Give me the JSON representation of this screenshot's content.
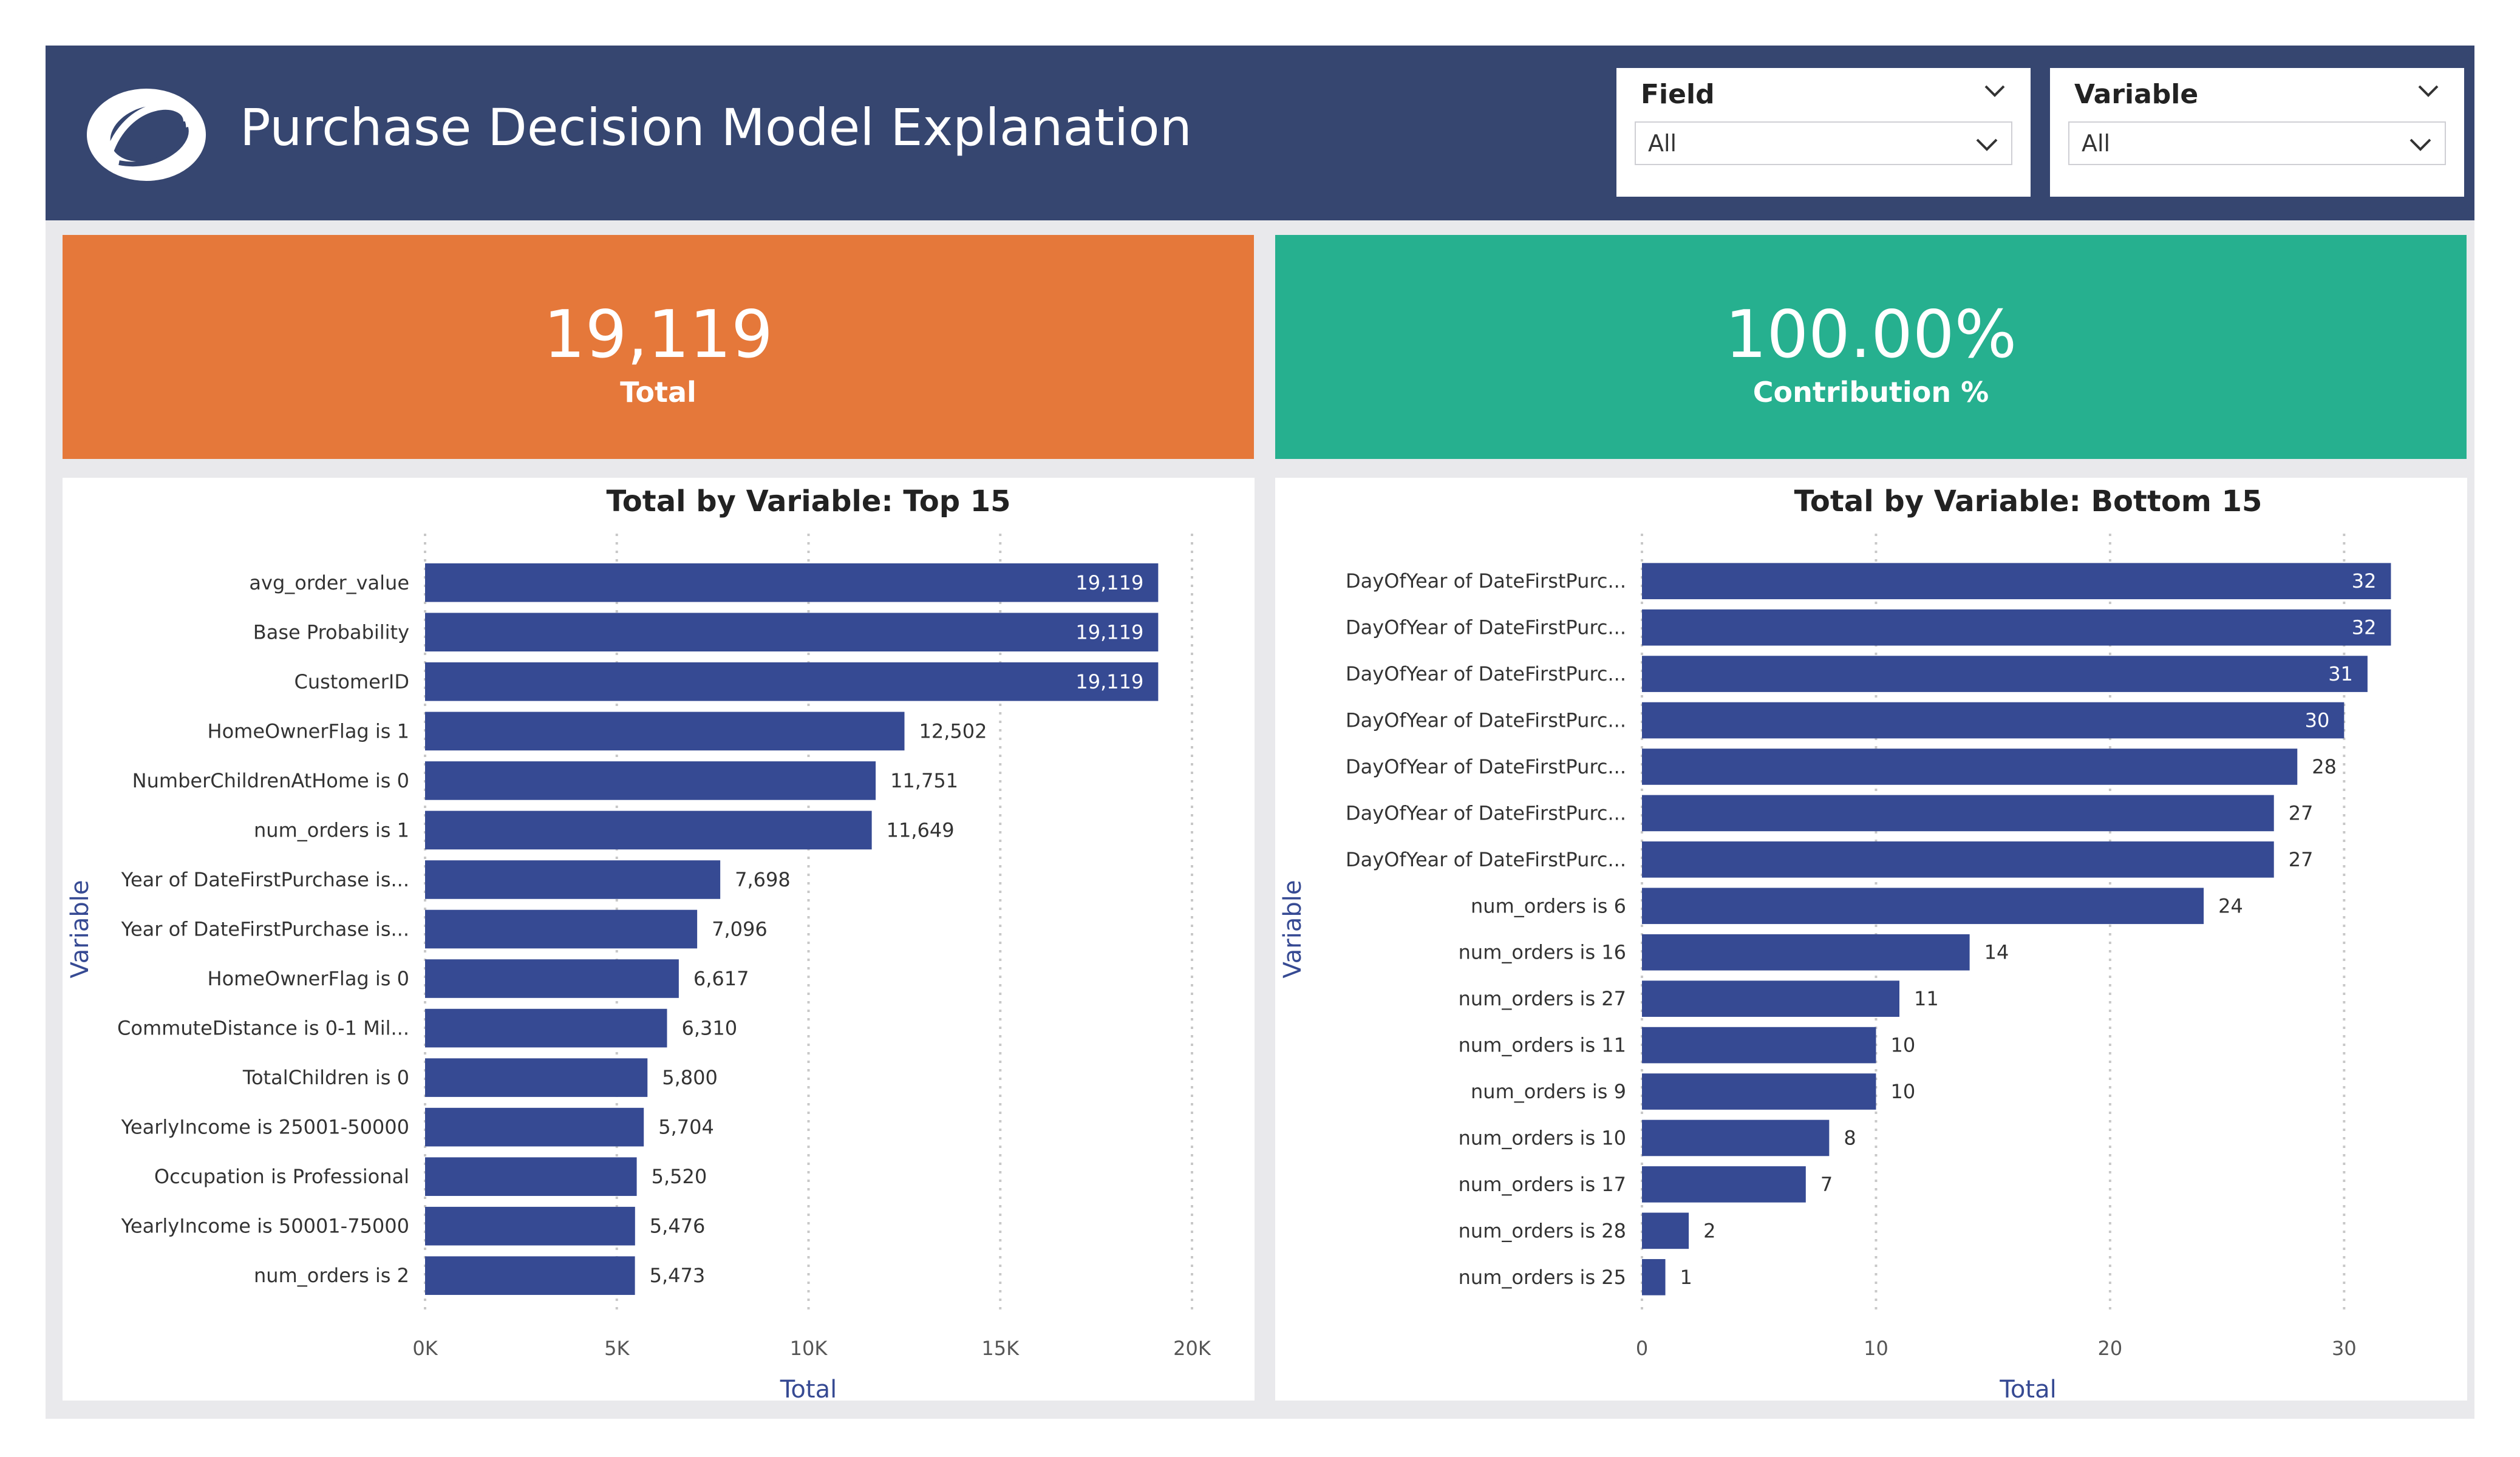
{
  "header": {
    "title": "Purchase Decision Model Explanation",
    "logo_icon": "ring-swirl-logo"
  },
  "filters": [
    {
      "label": "Field",
      "value": "All"
    },
    {
      "label": "Variable",
      "value": "All"
    }
  ],
  "cards": [
    {
      "value": "19,119",
      "label": "Total",
      "color": "#e5783a"
    },
    {
      "value": "100.00%",
      "label": "Contribution %",
      "color": "#26b08f"
    }
  ],
  "colors": {
    "header": "#364670",
    "bar": "#364a93",
    "axis_title": "#364a93",
    "frame": "#e9e9ec"
  },
  "chart_data": [
    {
      "type": "bar",
      "orientation": "horizontal",
      "title": "Total by Variable: Top 15",
      "xlabel": "Total",
      "ylabel": "Variable",
      "xlim": [
        0,
        20000
      ],
      "xticks": [
        0,
        5000,
        10000,
        15000,
        20000
      ],
      "xtick_labels": [
        "0K",
        "5K",
        "10K",
        "15K",
        "20K"
      ],
      "grid": true,
      "categories": [
        "avg_order_value",
        "Base Probability",
        "CustomerID",
        "HomeOwnerFlag is 1",
        "NumberChildrenAtHome is 0",
        "num_orders is 1",
        "Year of DateFirstPurchase is...",
        "Year of DateFirstPurchase is...",
        "HomeOwnerFlag is 0",
        "CommuteDistance is 0-1 Mil...",
        "TotalChildren is 0",
        "YearlyIncome is 25001-50000",
        "Occupation is Professional",
        "YearlyIncome is 50001-75000",
        "num_orders is 2"
      ],
      "values": [
        19119,
        19119,
        19119,
        12502,
        11751,
        11649,
        7698,
        7096,
        6617,
        6310,
        5800,
        5704,
        5520,
        5476,
        5473
      ],
      "data_labels": [
        "19,119",
        "19,119",
        "19,119",
        "12,502",
        "11,751",
        "11,649",
        "7,698",
        "7,096",
        "6,617",
        "6,310",
        "5,800",
        "5,704",
        "5,520",
        "5,476",
        "5,473"
      ]
    },
    {
      "type": "bar",
      "orientation": "horizontal",
      "title": "Total by Variable: Bottom 15",
      "xlabel": "Total",
      "ylabel": "Variable",
      "xlim": [
        0,
        33
      ],
      "xticks": [
        0,
        10,
        20,
        30
      ],
      "xtick_labels": [
        "0",
        "10",
        "20",
        "30"
      ],
      "grid": true,
      "categories": [
        "DayOfYear of DateFirstPurc...",
        "DayOfYear of DateFirstPurc...",
        "DayOfYear of DateFirstPurc...",
        "DayOfYear of DateFirstPurc...",
        "DayOfYear of DateFirstPurc...",
        "DayOfYear of DateFirstPurc...",
        "DayOfYear of DateFirstPurc...",
        "num_orders is 6",
        "num_orders is 16",
        "num_orders is 27",
        "num_orders is 11",
        "num_orders is 9",
        "num_orders is 10",
        "num_orders is 17",
        "num_orders is 28",
        "num_orders is 25"
      ],
      "values": [
        32,
        32,
        31,
        30,
        28,
        27,
        27,
        24,
        14,
        11,
        10,
        10,
        8,
        7,
        2,
        1
      ],
      "data_labels": [
        "32",
        "32",
        "31",
        "30",
        "28",
        "27",
        "27",
        "24",
        "14",
        "11",
        "10",
        "10",
        "8",
        "7",
        "2",
        "1"
      ]
    }
  ]
}
